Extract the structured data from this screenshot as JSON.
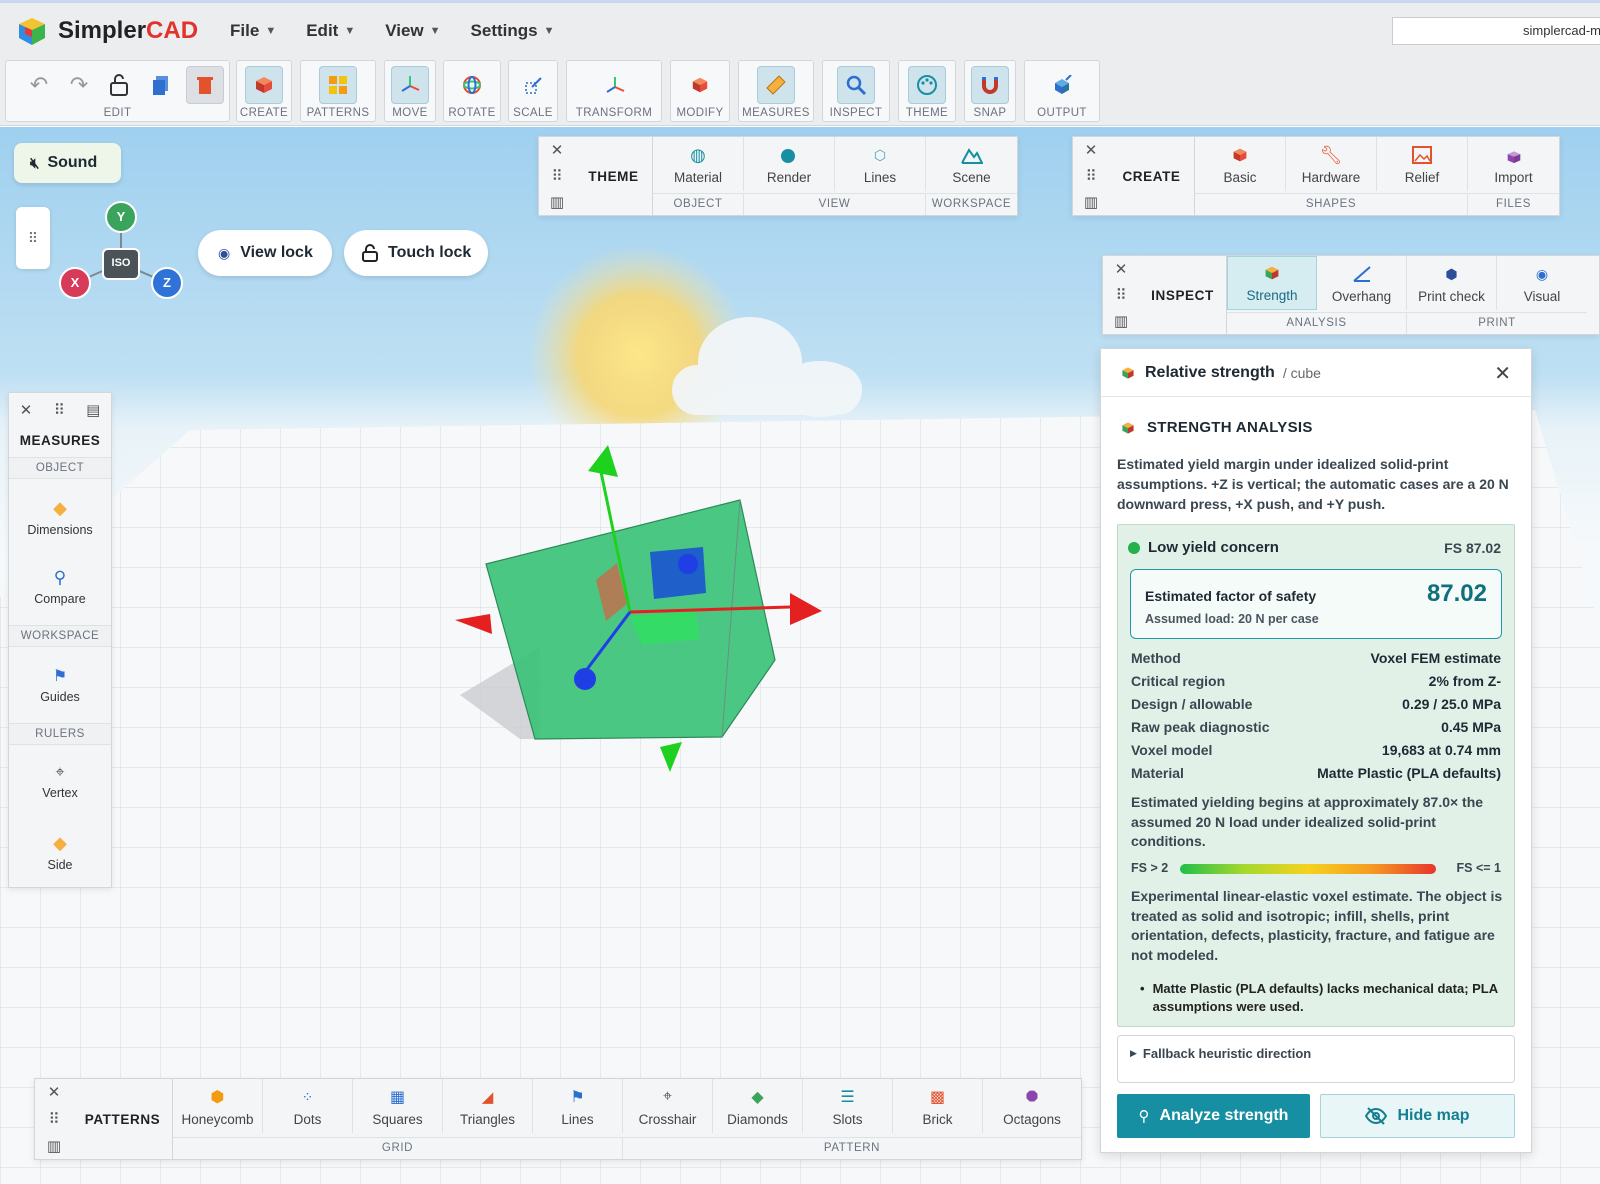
{
  "app": {
    "name_part1": "Simpler",
    "name_part2": "CAD",
    "url": "simplercad-m"
  },
  "menu": [
    "File",
    "Edit",
    "View",
    "Settings"
  ],
  "toolbar": {
    "groups": [
      "EDIT",
      "CREATE",
      "PATTERNS",
      "MOVE",
      "ROTATE",
      "SCALE",
      "TRANSFORM",
      "MODIFY",
      "MEASURES",
      "INSPECT",
      "THEME",
      "SNAP",
      "OUTPUT"
    ]
  },
  "sound": {
    "label": "Sound"
  },
  "axes": {
    "y": "Y",
    "x": "X",
    "z": "Z",
    "center": "ISO"
  },
  "locks": {
    "view": "View lock",
    "touch": "Touch lock"
  },
  "theme_panel": {
    "title": "THEME",
    "buttons": [
      "Material",
      "Render",
      "Lines",
      "Scene"
    ],
    "sections": [
      "OBJECT",
      "VIEW",
      "WORKSPACE"
    ]
  },
  "create_panel": {
    "title": "CREATE",
    "buttons": [
      "Basic",
      "Hardware",
      "Relief",
      "Import"
    ],
    "sections": [
      "SHAPES",
      "FILES"
    ]
  },
  "inspect_panel": {
    "title": "INSPECT",
    "buttons": [
      "Strength",
      "Overhang",
      "Print check",
      "Visual"
    ],
    "sections": [
      "ANALYSIS",
      "PRINT"
    ]
  },
  "measures_panel": {
    "title": "MEASURES",
    "sections": [
      "OBJECT",
      "WORKSPACE",
      "RULERS"
    ],
    "items": [
      "Dimensions",
      "Compare",
      "Guides",
      "Vertex",
      "Side"
    ]
  },
  "patterns_panel": {
    "title": "PATTERNS",
    "buttons": [
      "Honeycomb",
      "Dots",
      "Squares",
      "Triangles",
      "Lines",
      "Crosshair",
      "Diamonds",
      "Slots",
      "Brick",
      "Octagons"
    ],
    "sections": [
      "GRID",
      "PATTERN"
    ]
  },
  "strength": {
    "header_title": "Relative strength",
    "header_sub": "/ cube",
    "section_title": "STRENGTH ANALYSIS",
    "intro": "Estimated yield margin under idealized solid-print assumptions. +Z is vertical; the automatic cases are a 20 N downward press, +X push, and +Y push.",
    "status": "Low yield concern",
    "status_fs": "FS 87.02",
    "fos_label": "Estimated factor of safety",
    "fos_value": "87.02",
    "fos_load": "Assumed load: 20 N per case",
    "rows": [
      {
        "k": "Method",
        "v": "Voxel FEM estimate"
      },
      {
        "k": "Critical region",
        "v": "2% from Z-"
      },
      {
        "k": "Design / allowable",
        "v": "0.29 / 25.0 MPa"
      },
      {
        "k": "Raw peak diagnostic",
        "v": "0.45 MPa"
      },
      {
        "k": "Voxel model",
        "v": "19,683 at 0.74 mm"
      },
      {
        "k": "Material",
        "v": "Matte Plastic (PLA defaults)"
      }
    ],
    "yield_note": "Estimated yielding begins at approximately 87.0× the assumed 20 N load under idealized solid-print conditions.",
    "scale_left": "FS > 2",
    "scale_right": "FS <= 1",
    "disclaimer": "Experimental linear-elastic voxel estimate. The object is treated as solid and isotropic; infill, shells, print orientation, defects, plasticity, fracture, and fatigue are not modeled.",
    "bullet": "Matte Plastic (PLA defaults) lacks mechanical data; PLA assumptions were used.",
    "fallback": "Fallback heuristic direction",
    "analyze_btn": "Analyze strength",
    "hide_btn": "Hide map"
  },
  "colors": {
    "accent": "#178fa3",
    "status_green": "#22b14c",
    "cube": "#3cc27a"
  }
}
